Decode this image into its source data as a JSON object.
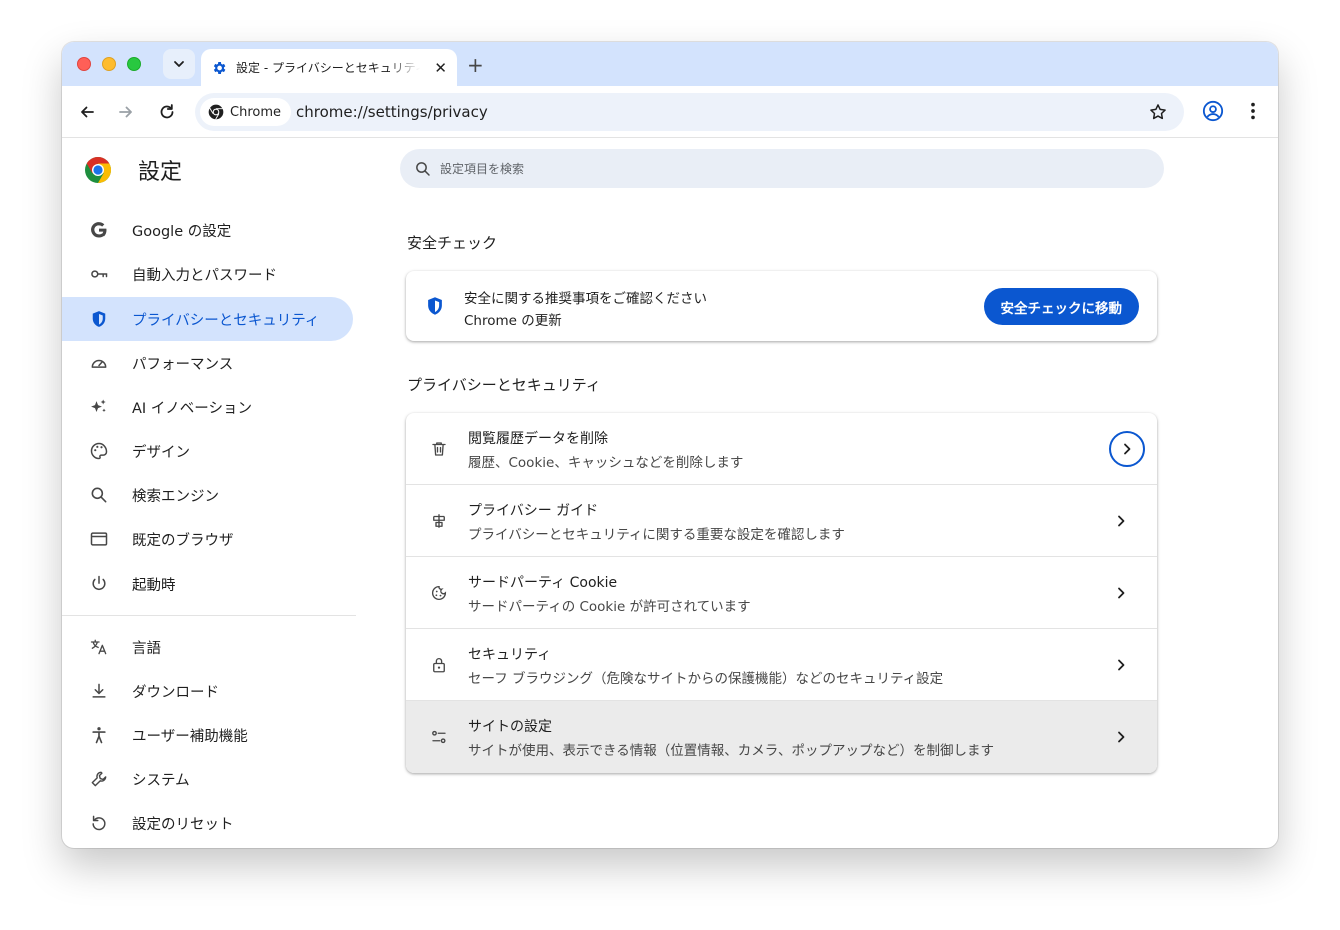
{
  "browser": {
    "tab_title": "設定 - プライバシーとセキュリティ",
    "new_tab_glyph": "+",
    "close_glyph": "✕",
    "chip_label": "Chrome",
    "url": "chrome://settings/privacy"
  },
  "settings": {
    "title": "設定",
    "search_placeholder": "設定項目を検索",
    "nav": [
      {
        "label": "Google の設定",
        "icon": "google-g-icon"
      },
      {
        "label": "自動入力とパスワード",
        "icon": "key-icon"
      },
      {
        "label": "プライバシーとセキュリティ",
        "icon": "shield-icon",
        "active": true
      },
      {
        "label": "パフォーマンス",
        "icon": "speedometer-icon"
      },
      {
        "label": "AI イノベーション",
        "icon": "sparkle-icon"
      },
      {
        "label": "デザイン",
        "icon": "palette-icon"
      },
      {
        "label": "検索エンジン",
        "icon": "search-icon"
      },
      {
        "label": "既定のブラウザ",
        "icon": "browser-window-icon"
      },
      {
        "label": "起動時",
        "icon": "power-icon"
      },
      {
        "label": "言語",
        "icon": "translate-icon"
      },
      {
        "label": "ダウンロード",
        "icon": "download-icon"
      },
      {
        "label": "ユーザー補助機能",
        "icon": "accessibility-icon"
      },
      {
        "label": "システム",
        "icon": "wrench-icon"
      },
      {
        "label": "設定のリセット",
        "icon": "reset-icon"
      }
    ]
  },
  "safety_check": {
    "heading": "安全チェック",
    "title": "安全に関する推奨事項をご確認ください",
    "subtitle": "Chrome の更新",
    "button": "安全チェックに移動"
  },
  "privacy": {
    "heading": "プライバシーとセキュリティ",
    "rows": [
      {
        "title": "閲覧履歴データを削除",
        "subtitle": "履歴、Cookie、キャッシュなどを削除します",
        "icon": "trash-icon"
      },
      {
        "title": "プライバシー ガイド",
        "subtitle": "プライバシーとセキュリティに関する重要な設定を確認します",
        "icon": "privacy-guide-icon"
      },
      {
        "title": "サードパーティ Cookie",
        "subtitle": "サードパーティの Cookie が許可されています",
        "icon": "cookie-icon"
      },
      {
        "title": "セキュリティ",
        "subtitle": "セーフ ブラウジング（危険なサイトからの保護機能）などのセキュリティ設定",
        "icon": "lock-icon"
      },
      {
        "title": "サイトの設定",
        "subtitle": "サイトが使用、表示できる情報（位置情報、カメラ、ポップアップなど）を制御します",
        "icon": "tune-icon"
      }
    ]
  },
  "colors": {
    "accent": "#0b57d0",
    "active_nav_bg": "#d3e3fd",
    "tabstrip_bg": "#d3e3fd"
  }
}
